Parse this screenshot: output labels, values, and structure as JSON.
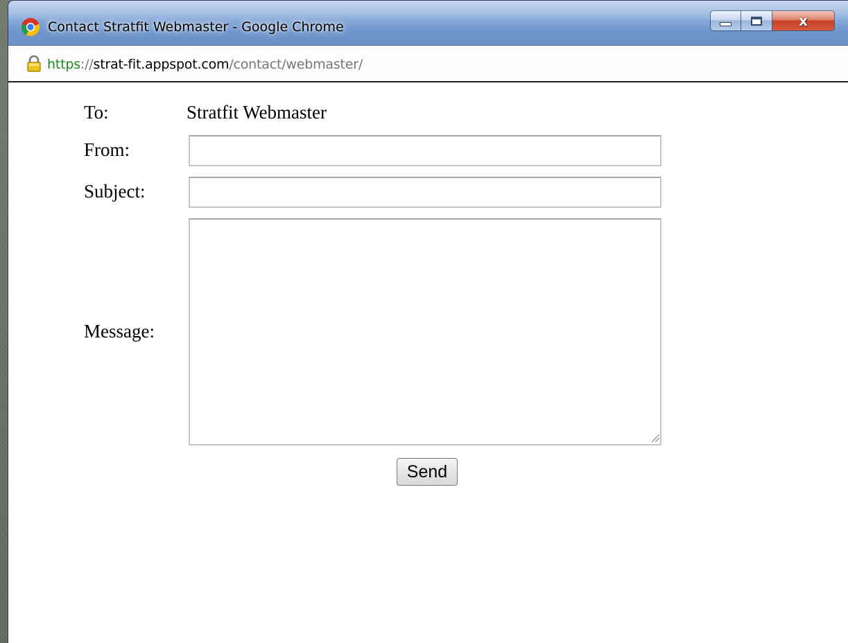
{
  "window": {
    "title": "Contact Stratfit Webmaster - Google Chrome",
    "close_label": "x"
  },
  "address_bar": {
    "scheme": "https",
    "separator": "://",
    "host": "strat-fit.appspot.com",
    "path": "/contact/webmaster/"
  },
  "form": {
    "to_label": "To:",
    "to_value": "Stratfit Webmaster",
    "from_label": "From:",
    "from_value": "",
    "subject_label": "Subject:",
    "subject_value": "",
    "message_label": "Message:",
    "message_value": "",
    "send_label": "Send"
  },
  "icons": {
    "app": "chrome-icon",
    "lock": "lock-icon",
    "minimize": "minimize-icon",
    "maximize": "maximize-icon",
    "close": "close-icon",
    "resize": "resize-grip-icon"
  },
  "colors": {
    "secure_scheme": "#1a8a1a",
    "url_path": "#777777",
    "title_bar": "#8fb0de",
    "close_button": "#c7412a"
  }
}
